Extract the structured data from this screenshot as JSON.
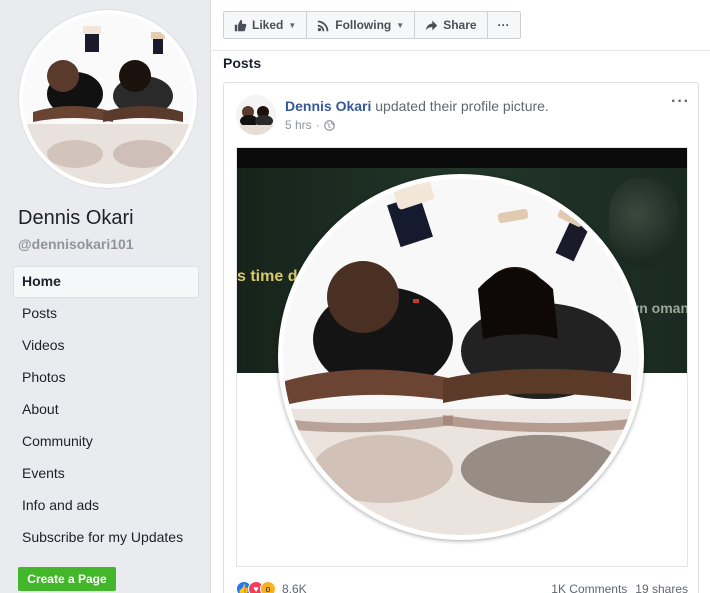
{
  "sidebar": {
    "page_name": "Dennis Okari",
    "handle": "@dennisokari101",
    "items": [
      {
        "label": "Home",
        "active": true
      },
      {
        "label": "Posts"
      },
      {
        "label": "Videos"
      },
      {
        "label": "Photos"
      },
      {
        "label": "About"
      },
      {
        "label": "Community"
      },
      {
        "label": "Events"
      },
      {
        "label": "Info and ads"
      },
      {
        "label": "Subscribe for my Updates"
      }
    ],
    "create_page_label": "Create a Page"
  },
  "action_bar": {
    "liked_label": "Liked",
    "following_label": "Following",
    "share_label": "Share",
    "more_label": "···"
  },
  "posts_heading": "Posts",
  "post": {
    "author": "Dennis Okari",
    "action_text": "updated their profile picture.",
    "time": "5 hrs",
    "privacy_icon": "globe-icon",
    "more_label": "···",
    "cover_left_text": "s time drink",
    "cover_right_text": "onyn oman",
    "reaction_count": "8.6K",
    "comments": "1K Comments",
    "shares": "19 shares"
  },
  "colors": {
    "link": "#365899",
    "create_button": "#42b72a",
    "background": "#e9ebee"
  }
}
